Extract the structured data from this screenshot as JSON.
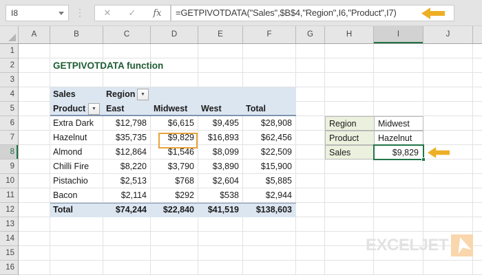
{
  "formula_bar": {
    "cell_reference": "I8",
    "cancel_label": "✕",
    "enter_label": "✓",
    "fx_label": "fx",
    "formula": "=GETPIVOTDATA(\"Sales\",$B$4,\"Region\",I6,\"Product\",I7)"
  },
  "grid": {
    "column_headers": [
      "A",
      "B",
      "C",
      "D",
      "E",
      "F",
      "G",
      "H",
      "I",
      "J"
    ],
    "row_headers": [
      "1",
      "2",
      "3",
      "4",
      "5",
      "6",
      "7",
      "8",
      "9",
      "10",
      "11",
      "12",
      "13",
      "14",
      "15",
      "16"
    ],
    "selected_column": "I",
    "selected_row": "8"
  },
  "sheet": {
    "title": "GETPIVOTDATA function"
  },
  "pivot_table": {
    "value_field_label": "Sales",
    "column_field_label": "Region",
    "row_field_label": "Product",
    "column_headers": [
      "East",
      "Midwest",
      "West",
      "Total"
    ],
    "rows": [
      {
        "label": "Extra Dark",
        "values": [
          "$12,798",
          "$6,615",
          "$9,495",
          "$28,908"
        ]
      },
      {
        "label": "Hazelnut",
        "values": [
          "$35,735",
          "$9,829",
          "$16,893",
          "$62,456"
        ]
      },
      {
        "label": "Almond",
        "values": [
          "$12,864",
          "$1,546",
          "$8,099",
          "$22,509"
        ]
      },
      {
        "label": "Chilli Fire",
        "values": [
          "$8,220",
          "$3,790",
          "$3,890",
          "$15,900"
        ]
      },
      {
        "label": "Pistachio",
        "values": [
          "$2,513",
          "$768",
          "$2,604",
          "$5,885"
        ]
      },
      {
        "label": "Bacon",
        "values": [
          "$2,114",
          "$292",
          "$538",
          "$2,944"
        ]
      }
    ],
    "total_row": {
      "label": "Total",
      "values": [
        "$74,244",
        "$22,840",
        "$41,519",
        "$138,603"
      ]
    },
    "highlighted_value": "$9,829"
  },
  "lookup_panel": {
    "rows": [
      {
        "label": "Region",
        "value": "Midwest"
      },
      {
        "label": "Product",
        "value": "Hazelnut"
      },
      {
        "label": "Sales",
        "value": "$9,829"
      }
    ]
  },
  "logo": {
    "text": "EXCELJET"
  },
  "colors": {
    "accent_green": "#217346",
    "arrow_gold": "#EDAF25",
    "highlight_orange": "#E8A33C",
    "pivot_header_bg": "#DCE6F1",
    "lookup_label_bg": "#EBF1DE",
    "title_green": "#1D5B33"
  }
}
